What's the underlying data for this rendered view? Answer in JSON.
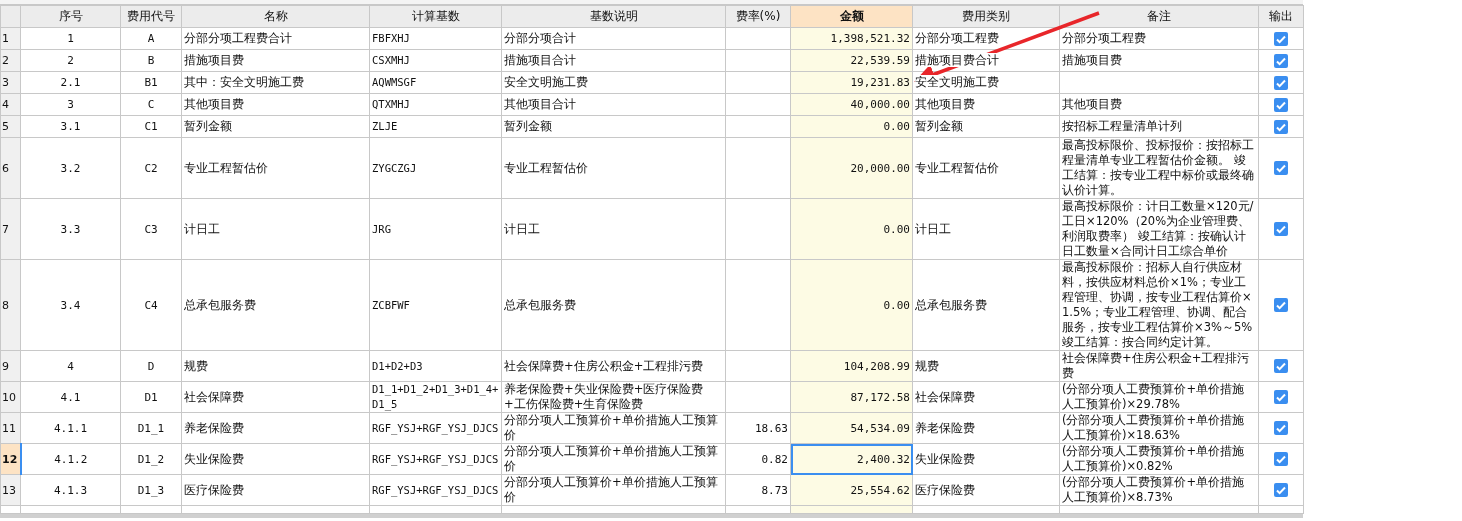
{
  "columns": [
    "序号",
    "费用代号",
    "名称",
    "计算基数",
    "基数说明",
    "费率(%)",
    "金额",
    "费用类别",
    "备注",
    "输出"
  ],
  "rows": [
    {
      "row_number": "1",
      "seq": "1",
      "code": "A",
      "name": "分部分项工程费合计",
      "base": "FBFXHJ",
      "base_desc": "分部分项合计",
      "rate": "",
      "amount": "1,398,521.32",
      "category": "分部分项工程费",
      "note": "分部分项工程费",
      "output": true,
      "selected": false
    },
    {
      "row_number": "2",
      "seq": "2",
      "code": "B",
      "name": "措施项目费",
      "base": "CSXMHJ",
      "base_desc": "措施项目合计",
      "rate": "",
      "amount": "22,539.59",
      "category": "措施项目费合计",
      "note": "措施项目费",
      "output": true,
      "selected": false
    },
    {
      "row_number": "3",
      "seq": "2.1",
      "code": "B1",
      "name": "其中：安全文明施工费",
      "base": "AQWMSGF",
      "base_desc": "安全文明施工费",
      "rate": "",
      "amount": "19,231.83",
      "category": "安全文明施工费",
      "note": "",
      "output": true,
      "selected": false
    },
    {
      "row_number": "4",
      "seq": "3",
      "code": "C",
      "name": "其他项目费",
      "base": "QTXMHJ",
      "base_desc": "其他项目合计",
      "rate": "",
      "amount": "40,000.00",
      "category": "其他项目费",
      "note": "其他项目费",
      "output": true,
      "selected": false
    },
    {
      "row_number": "5",
      "seq": "3.1",
      "code": "C1",
      "name": "暂列金额",
      "base": "ZLJE",
      "base_desc": "暂列金额",
      "rate": "",
      "amount": "0.00",
      "category": "暂列金额",
      "note": "按招标工程量清单计列",
      "output": true,
      "selected": false
    },
    {
      "row_number": "6",
      "seq": "3.2",
      "code": "C2",
      "name": "专业工程暂估价",
      "base": "ZYGCZGJ",
      "base_desc": "专业工程暂估价",
      "rate": "",
      "amount": "20,000.00",
      "category": "专业工程暂估价",
      "note": "最高投标限价、投标报价：按招标工程量清单专业工程暂估价金额。 竣工结算：按专业工程中标价或最终确认价计算。",
      "output": true,
      "selected": false
    },
    {
      "row_number": "7",
      "seq": "3.3",
      "code": "C3",
      "name": "计日工",
      "base": "JRG",
      "base_desc": "计日工",
      "rate": "",
      "amount": "0.00",
      "category": "计日工",
      "note": "最高投标限价：计日工数量×120元/工日×120%（20%为企业管理费、利润取费率） 竣工结算：按确认计日工数量×合同计日工综合单价",
      "output": true,
      "selected": false
    },
    {
      "row_number": "8",
      "seq": "3.4",
      "code": "C4",
      "name": "总承包服务费",
      "base": "ZCBFWF",
      "base_desc": "总承包服务费",
      "rate": "",
      "amount": "0.00",
      "category": "总承包服务费",
      "note": "最高投标限价：招标人自行供应材料，按供应材料总价×1%；专业工程管理、协调，按专业工程估算价×1.5%；专业工程管理、协调、配合服务，按专业工程估算价×3%～5% 竣工结算：按合同约定计算。",
      "output": true,
      "selected": false
    },
    {
      "row_number": "9",
      "seq": "4",
      "code": "D",
      "name": "规费",
      "base": "D1+D2+D3",
      "base_desc": "社会保障费+住房公积金+工程排污费",
      "rate": "",
      "amount": "104,208.99",
      "category": "规费",
      "note": "社会保障费+住房公积金+工程排污费",
      "output": true,
      "selected": false
    },
    {
      "row_number": "10",
      "seq": "4.1",
      "code": "D1",
      "name": "社会保障费",
      "base": "D1_1+D1_2+D1_3+D1_4+D1_5",
      "base_desc": "养老保险费+失业保险费+医疗保险费+工伤保险费+生育保险费",
      "rate": "",
      "amount": "87,172.58",
      "category": "社会保障费",
      "note": "(分部分项人工费预算价+单价措施人工预算价)×29.78%",
      "output": true,
      "selected": false
    },
    {
      "row_number": "11",
      "seq": "4.1.1",
      "code": "D1_1",
      "name": "养老保险费",
      "base": "RGF_YSJ+RGF_YSJ_DJCS",
      "base_desc": "分部分项人工预算价+单价措施人工预算价",
      "rate": "18.63",
      "amount": "54,534.09",
      "category": "养老保险费",
      "note": "(分部分项人工费预算价+单价措施人工预算价)×18.63%",
      "output": true,
      "selected": false
    },
    {
      "row_number": "12",
      "seq": "4.1.2",
      "code": "D1_2",
      "name": "失业保险费",
      "base": "RGF_YSJ+RGF_YSJ_DJCS",
      "base_desc": "分部分项人工预算价+单价措施人工预算价",
      "rate": "0.82",
      "amount": "2,400.32",
      "category": "失业保险费",
      "note": "(分部分项人工费预算价+单价措施人工预算价)×0.82%",
      "output": true,
      "selected": true
    },
    {
      "row_number": "13",
      "seq": "4.1.3",
      "code": "D1_3",
      "name": "医疗保险费",
      "base": "RGF_YSJ+RGF_YSJ_DJCS",
      "base_desc": "分部分项人工预算价+单价措施人工预算价",
      "rate": "8.73",
      "amount": "25,554.62",
      "category": "医疗保险费",
      "note": "(分部分项人工费预算价+单价措施人工预算价)×8.73%",
      "output": true,
      "selected": false
    }
  ]
}
